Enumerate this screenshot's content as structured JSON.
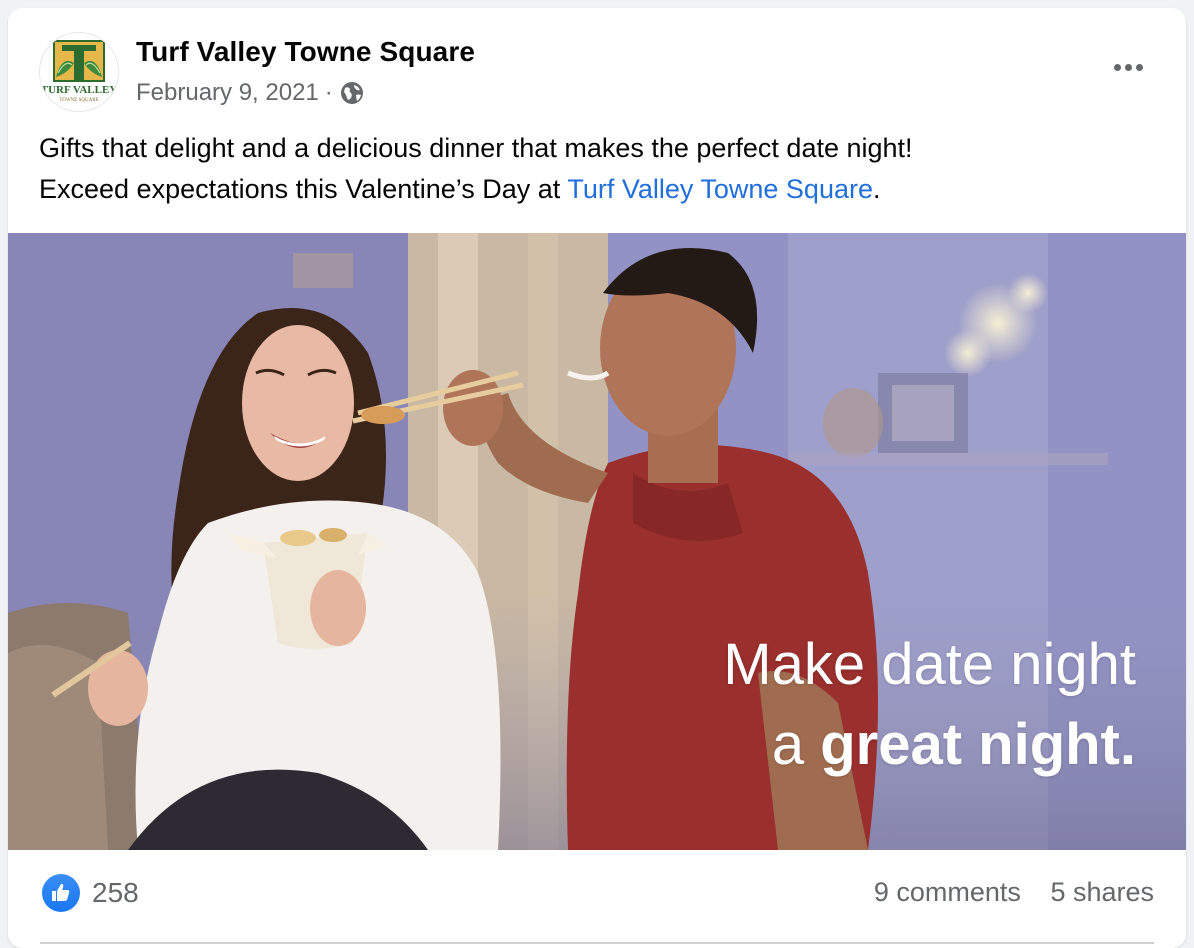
{
  "post": {
    "page_name": "Turf Valley Towne Square",
    "date": "February 9, 2021",
    "separator": "·",
    "privacy_icon": "globe-icon",
    "more_icon": "more-options-icon",
    "text_line1": "Gifts that delight and a delicious dinner that makes the perfect date night!",
    "text_line2_prefix": "Exceed expectations this Valentine’s Day at ",
    "text_link": "Turf Valley Towne Square",
    "text_line2_suffix": "."
  },
  "avatar": {
    "logo_text_top": "TURF VALLEY",
    "logo_text_bottom": "TOWNE SQUARE"
  },
  "photo": {
    "overlay_line1": "Make date night",
    "overlay_line2_prefix": "a ",
    "overlay_line2_bold": "great night."
  },
  "footer": {
    "reaction_icon": "like-icon",
    "like_count": "258",
    "comments": "9 comments",
    "shares": "5 shares"
  },
  "colors": {
    "link": "#216fdb",
    "like_blue": "#1877f2",
    "secondary_text": "#65676b"
  }
}
